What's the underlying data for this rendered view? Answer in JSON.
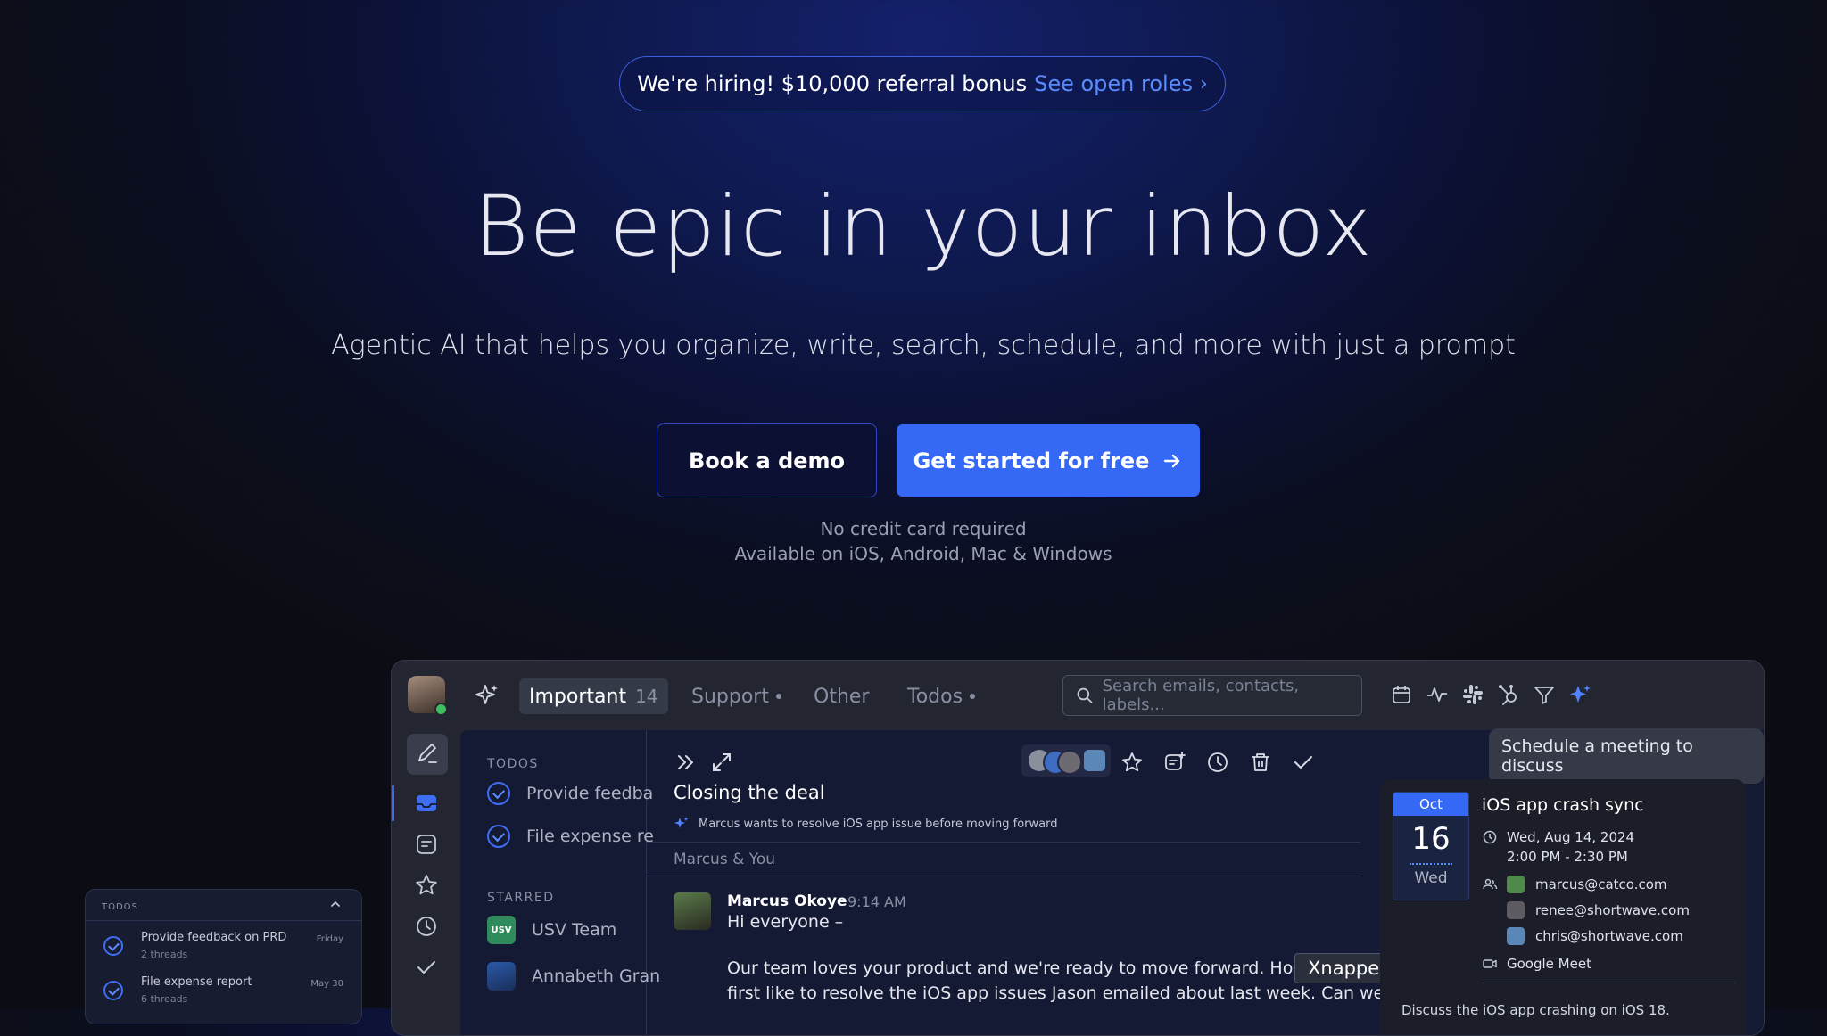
{
  "banner": {
    "text": "We're hiring! $10,000 referral bonus",
    "link": "See open roles",
    "chevron": "›"
  },
  "hero": {
    "headline": "Be epic in your inbox",
    "subline": "Agentic AI that helps you organize, write, search, schedule, and more with just a prompt",
    "demo_button": "Book a demo",
    "start_button": "Get started for free",
    "note1": "No credit card required",
    "note2": "Available on iOS, Android, Mac & Windows"
  },
  "app": {
    "tabs": [
      {
        "label": "Important",
        "count": "14"
      },
      {
        "label": "Support"
      },
      {
        "label": "Other"
      },
      {
        "label": "Todos"
      }
    ],
    "search_placeholder": "Search emails, contacts, labels...",
    "toolbar_icons": [
      "calendar-icon",
      "activity-icon",
      "slack-icon",
      "hubspot-icon",
      "filter-icon",
      "sparkle-icon"
    ],
    "list": {
      "todos_header": "TODOS",
      "todos": [
        "Provide feedba",
        "File expense re"
      ],
      "starred_header": "STARRED",
      "starred": [
        {
          "badge": "USV",
          "label": "USV Team"
        },
        {
          "label": "Annabeth Gran"
        }
      ]
    },
    "email": {
      "title": "Closing the deal",
      "summary": "Marcus wants to resolve iOS app issue before moving forward",
      "participants": "Marcus & You",
      "sender": "Marcus Okoye",
      "time": "9:14 AM",
      "greeting": "Hi everyone –",
      "line1": "Our team loves your product and we're ready to move forward. How",
      "line2": "first like to resolve the iOS app issues Jason emailed about last week. Can we"
    },
    "tooltip": "Xnapper",
    "prompt": "Schedule a meeting to discuss",
    "event": {
      "month": "Oct",
      "day": "16",
      "weekday": "Wed",
      "title": "iOS app crash sync",
      "date": "Wed, Aug 14, 2024",
      "time": "2:00 PM - 2:30 PM",
      "guests": [
        "marcus@catco.com",
        "renee@shortwave.com",
        "chris@shortwave.com"
      ],
      "location": "Google Meet",
      "description": "Discuss the iOS app crashing on iOS 18."
    }
  },
  "todo_widget": {
    "header": "TODOS",
    "items": [
      {
        "title": "Provide feedback on PRD",
        "sub": "2 threads",
        "date": "Friday"
      },
      {
        "title": "File expense report",
        "sub": "6 threads",
        "date": "May 30"
      }
    ]
  }
}
